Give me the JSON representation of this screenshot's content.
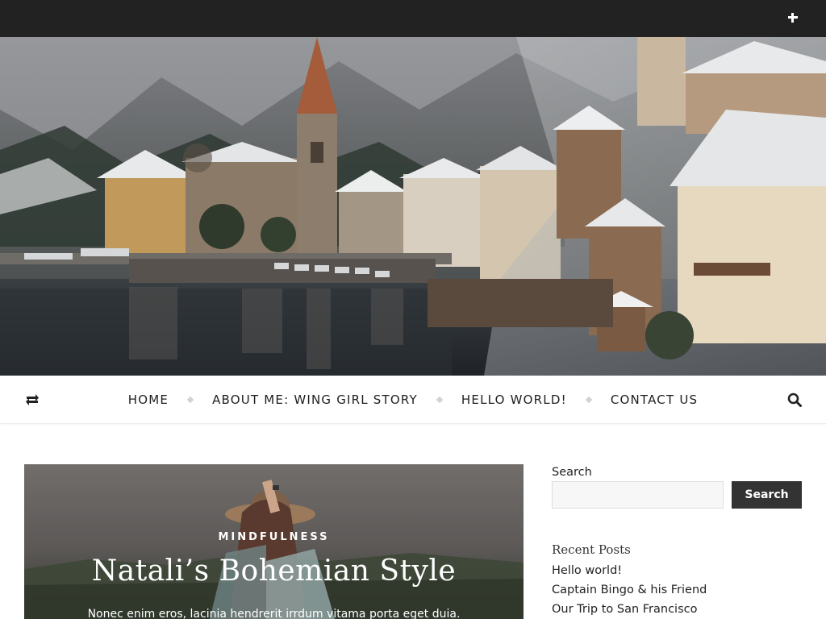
{
  "topbar": {
    "toggle_icon": "plus-icon"
  },
  "nav": {
    "shuffle_icon": "shuffle-icon",
    "items": [
      {
        "label": "HOME"
      },
      {
        "label": "ABOUT ME: WING GIRL STORY"
      },
      {
        "label": "HELLO WORLD!"
      },
      {
        "label": "CONTACT US"
      }
    ],
    "search_icon": "search-icon"
  },
  "featured": {
    "category": "MINDFULNESS",
    "title": "Natali’s Bohemian Style",
    "excerpt": "Nonec enim eros, lacinia hendrerit irrdum vitama porta eget duia."
  },
  "sidebar": {
    "search_label": "Search",
    "search_value": "",
    "search_button": "Search",
    "recent_posts_title": "Recent Posts",
    "recent_posts": [
      "Hello world!",
      "Captain Bingo & his Friend",
      "Our Trip to San Francisco"
    ]
  },
  "colors": {
    "topbar": "#222222",
    "button": "#333333",
    "nav_separator": "#d2d2d2"
  }
}
